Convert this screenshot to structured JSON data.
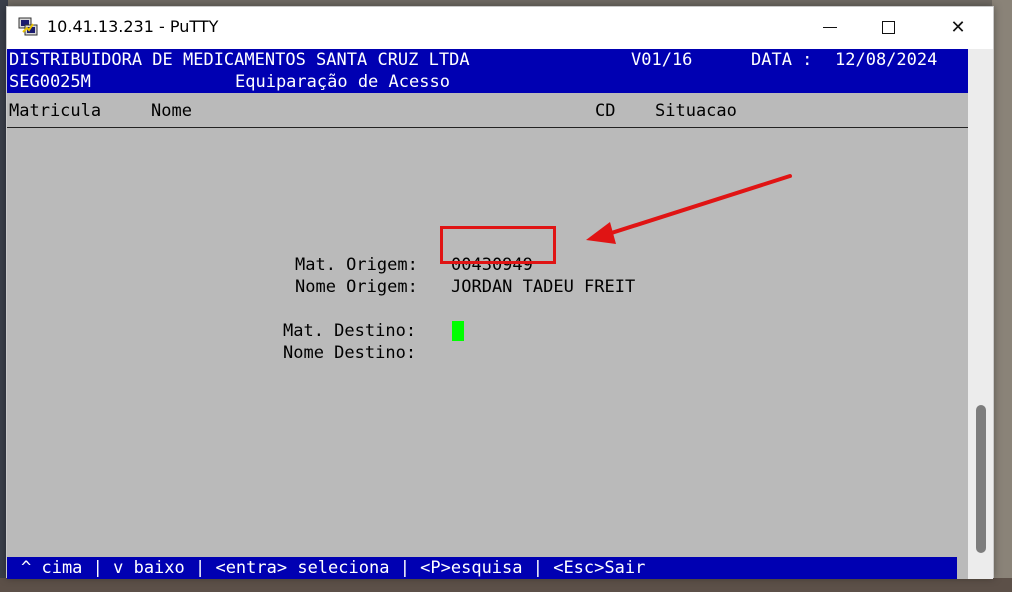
{
  "window": {
    "title": "10.41.13.231 - PuTTY",
    "controls": {
      "close": "✕"
    }
  },
  "terminal": {
    "company": "DISTRIBUIDORA DE MEDICAMENTOS SANTA CRUZ LTDA",
    "version": "V01/16",
    "date_label": "DATA :",
    "date_value": "12/08/2024",
    "program_code": "SEG0025M",
    "screen_title": "Equiparação de Acesso",
    "columns": [
      "Matricula",
      "Nome",
      "CD",
      "Situacao"
    ],
    "fields": {
      "origin_mat_label": "Mat. Origem:",
      "origin_mat_value": "00430949",
      "origin_name_label": "Nome Origem:",
      "origin_name_value": "JORDAN TADEU FREIT",
      "dest_mat_label": "Mat. Destino:",
      "dest_name_label": "Nome Destino:"
    },
    "footer": "^ cima | v baixo | <entra> seleciona | <P>esquisa | <Esc>Sair"
  },
  "colors": {
    "header_blue": "#0000b2",
    "terminal_bg": "#bababa",
    "cursor": "#00ff00",
    "annotation_red": "#e01414"
  }
}
